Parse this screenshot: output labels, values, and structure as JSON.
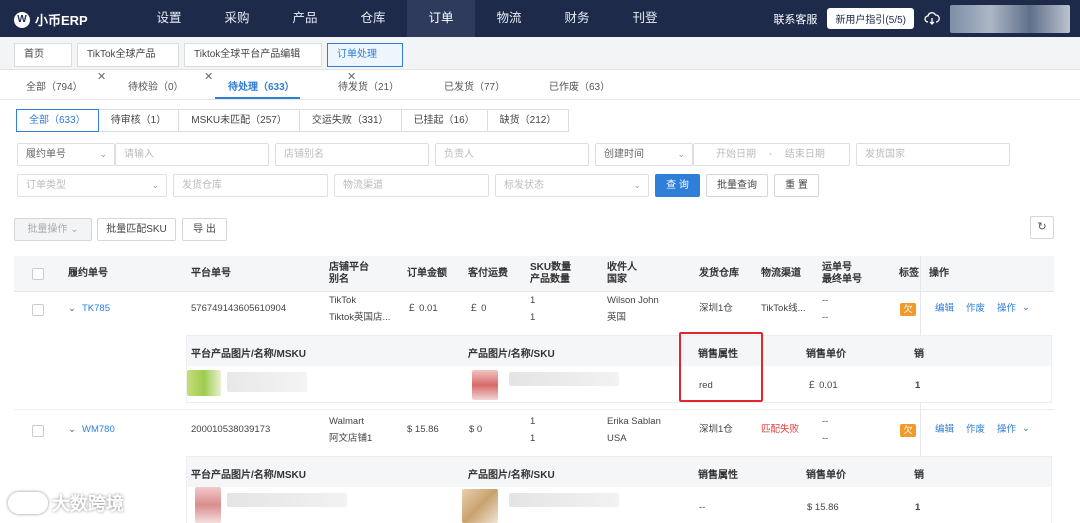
{
  "app": {
    "name": "小币ERP",
    "logo_glyph": "W"
  },
  "nav": [
    "设置",
    "采购",
    "产品",
    "仓库",
    "订单",
    "物流",
    "财务",
    "刊登"
  ],
  "nav_active": "订单",
  "top_right": {
    "support": "联系客服",
    "guide": "新用户指引(5/5)"
  },
  "page_tabs": [
    {
      "label": "首页"
    },
    {
      "label": "TikTok全球产品",
      "close": "✕"
    },
    {
      "label": "Tiktok全球平台产品编辑",
      "close": "✕"
    },
    {
      "label": "订单处理",
      "close": "✕"
    }
  ],
  "status_tabs": [
    "全部（794）",
    "待校验（0）",
    "待处理（633）",
    "待发货（21）",
    "已发货（77）",
    "已作废（63）"
  ],
  "filter_tabs": [
    "全部（633）",
    "待审核（1）",
    "MSKU未匹配（257）",
    "交运失败（331）",
    "已挂起（16）",
    "缺货（212）"
  ],
  "filters": {
    "search_type": "履约单号",
    "search_placeholder": "请输入",
    "shop_alias": "店铺别名",
    "owner": "负责人",
    "time_type": "创建时间",
    "start_date": "开始日期",
    "date_sep": "-",
    "end_date": "结束日期",
    "ship_country": "发货国家",
    "order_type": "订单类型",
    "ship_warehouse": "发货仓库",
    "logistics": "物流渠道",
    "tag_status": "标发状态",
    "query": "查 询",
    "batch_query": "批量查询",
    "reset": "重 置"
  },
  "actions": {
    "batch_ops": "批量操作",
    "batch_match": "批量匹配SKU",
    "export": "导 出",
    "refresh_icon": "↻"
  },
  "table_headers": {
    "fulfill_no": "履约单号",
    "platform_no": "平台单号",
    "shop_platform": "店铺平台",
    "shop_alias": "别名",
    "amount": "订单金额",
    "shipping": "客付运费",
    "sku_qty": "SKU数量",
    "product_qty": "产品数量",
    "receiver": "收件人",
    "country": "国家",
    "warehouse": "发货仓库",
    "channel": "物流渠道",
    "tracking": "运单号",
    "last_tracking": "最终单号",
    "tag": "标签",
    "ops": "操作"
  },
  "orders": [
    {
      "fulfill_no": "TK785",
      "platform_no": "576749143605610904",
      "platform": "TikTok",
      "shop": "Tiktok英国店...",
      "amount": "￡ 0.01",
      "shipping": "￡ 0",
      "sku_qty": "1",
      "product_qty": "1",
      "receiver": "Wilson John",
      "country": "英国",
      "warehouse": "深圳1仓",
      "channel": "TikTok线...",
      "tracking": "--",
      "last_tracking": "--",
      "tag": "欠",
      "ops": [
        "编辑",
        "作废",
        "操作"
      ],
      "items": [
        {
          "sale_attr": "red",
          "price": "￡ 0.01",
          "qty": "1"
        }
      ]
    },
    {
      "fulfill_no": "WM780",
      "platform_no": "200010538039173",
      "platform": "Walmart",
      "shop": "阿文店铺1",
      "amount": "$ 15.86",
      "shipping": "$ 0",
      "sku_qty": "1",
      "product_qty": "1",
      "receiver": "Erika Sablan",
      "country": "USA",
      "warehouse": "深圳1仓",
      "channel": "匹配失败",
      "tracking": "--",
      "last_tracking": "--",
      "tag": "欠",
      "ops": [
        "编辑",
        "作废",
        "操作"
      ],
      "items": [
        {
          "sale_attr": "--",
          "price": "$ 15.86",
          "qty": "1"
        }
      ]
    }
  ],
  "sub_headers": {
    "platform_product": "平台产品图片/名称/MSKU",
    "product": "产品图片/名称/SKU",
    "sale_attr": "销售属性",
    "unit_price": "销售单价",
    "sale_qty": "销"
  },
  "watermark": "大数跨境",
  "colors": {
    "topbar": "#1d2a4a",
    "primary": "#2f7ed8",
    "error": "#e23b3b",
    "tag": "#f09a2b",
    "highlight": "#e3262e"
  }
}
